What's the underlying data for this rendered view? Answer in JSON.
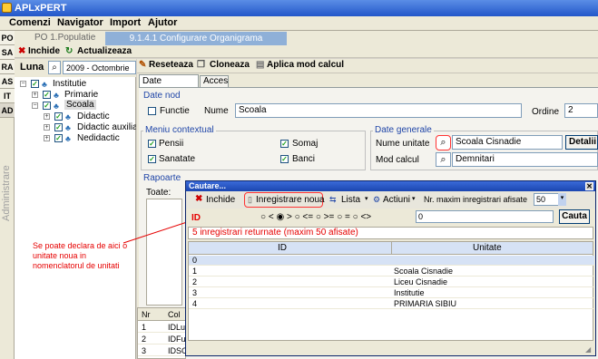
{
  "window": {
    "title": "APLxPERT"
  },
  "menu": [
    "Comenzi",
    "Navigator",
    "Import",
    "Ajutor"
  ],
  "left_tabs": [
    "PO",
    "SA",
    "RA",
    "AS",
    "IT",
    "AD"
  ],
  "left_vertical_label": "Administrare",
  "doc_tabs": {
    "tab1": "PO 1.Populatie",
    "tab2": "9.1.4.1 Configurare Organigrama"
  },
  "toolbar1": {
    "close": "Inchide",
    "refresh": "Actualizeaza"
  },
  "left_panel": {
    "month_label": "Luna",
    "month_value": "2009 - Octombrie",
    "tree": [
      {
        "label": "Institutie"
      },
      {
        "label": "Primarie"
      },
      {
        "label": "Scoala"
      },
      {
        "label": "Didactic"
      },
      {
        "label": "Didactic auxiliar"
      },
      {
        "label": "Nedidactic"
      }
    ]
  },
  "right_toolbar": {
    "reset": "Reseteaza",
    "clone": "Cloneaza",
    "apply": "Aplica mod calcul"
  },
  "right_tabs": {
    "general": "Date generale",
    "access": "Acces"
  },
  "date_nod": {
    "title": "Date nod",
    "function_label": "Functie",
    "name_label": "Nume",
    "name_value": "Scoala",
    "order_label": "Ordine",
    "order_value": "2"
  },
  "meniu": {
    "title": "Meniu contextual",
    "items": [
      "Pensii",
      "Somaj",
      "Sanatate",
      "Banci"
    ]
  },
  "date_generale": {
    "title": "Date generale",
    "unit_label": "Nume unitate",
    "unit_value": "Scoala Cisnadie",
    "details_button": "Detalii",
    "calc_label": "Mod calcul",
    "calc_value": "Demnitari"
  },
  "rapoarte": {
    "title": "Rapoarte",
    "toate": "Toate:"
  },
  "bottom_grid": {
    "header": [
      "Nr",
      "Col"
    ],
    "rows": [
      [
        "1",
        "IDLu"
      ],
      [
        "2",
        "IDFu"
      ],
      [
        "3",
        "IDSC"
      ]
    ]
  },
  "dialog": {
    "title": "Cautare...",
    "close": "Inchide",
    "new_record": "Inregistrare noua",
    "list": "Lista",
    "actions": "Actiuni",
    "max_label": "Nr. maxim inregistrari afisate",
    "max_value": "50",
    "field": "ID",
    "operators": [
      "<",
      ">",
      "<=",
      ">=",
      "=",
      "<>"
    ],
    "search_value": "0",
    "search_button": "Cauta",
    "status": "5 inregistrari returnate (maxim 50 afisate)",
    "columns": [
      "ID",
      "Unitate"
    ],
    "rows": [
      {
        "id": "0",
        "unit": ""
      },
      {
        "id": "1",
        "unit": "Scoala Cisnadie"
      },
      {
        "id": "2",
        "unit": "Liceu Cisnadie"
      },
      {
        "id": "3",
        "unit": "Institutie"
      },
      {
        "id": "4",
        "unit": "PRIMARIA SIBIU"
      }
    ]
  },
  "annotation": "Se poate declara de aici o unitate noua in nomenclatorul de unitati",
  "colors": {
    "accent": "#2046a8",
    "annotation": "#e60000",
    "highlight": "#ff3333",
    "grid_header": "#d6e2f5"
  }
}
